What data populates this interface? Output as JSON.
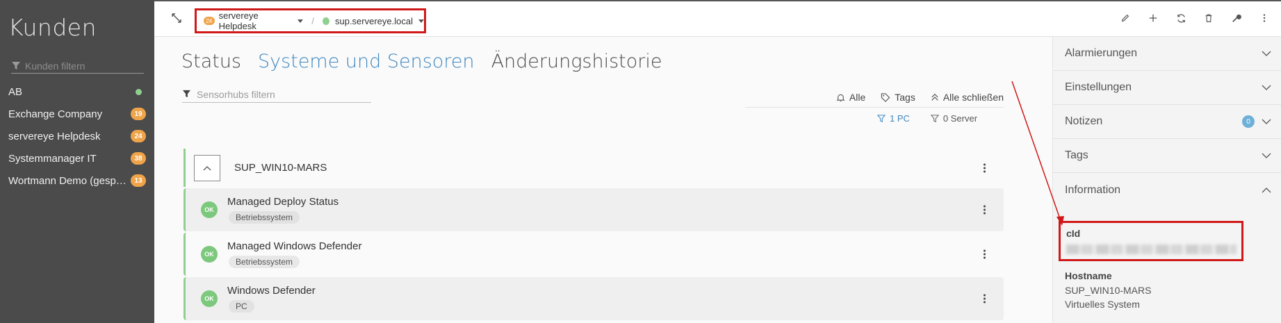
{
  "sidebar": {
    "title": "Kunden",
    "filter_placeholder": "Kunden filtern",
    "items": [
      {
        "name": "AB",
        "status": "online"
      },
      {
        "name": "Exchange Company",
        "count": "19"
      },
      {
        "name": "servereye Helpdesk",
        "count": "24"
      },
      {
        "name": "Systemmanager IT",
        "count": "38"
      },
      {
        "name": "Wortmann Demo (gespo...",
        "count": "13"
      }
    ]
  },
  "breadcrumb": {
    "customer_badge": "24",
    "customer": "servereye Helpdesk",
    "separator": "/",
    "system": "sup.servereye.local"
  },
  "toolbar": {
    "icons": [
      "pencil-icon",
      "plus-icon",
      "refresh-icon",
      "trash-icon",
      "wrench-icon",
      "more-vertical-icon"
    ]
  },
  "main": {
    "tabs": [
      {
        "label": "Status",
        "active": false
      },
      {
        "label": "Systeme und Sensoren",
        "active": true
      },
      {
        "label": "Änderungshistorie",
        "active": false
      }
    ],
    "hub_filter_placeholder": "Sensorhubs filtern",
    "actions": {
      "all": "Alle",
      "tags": "Tags",
      "close_all": "Alle schließen",
      "pc": "1 PC",
      "server": "0 Server"
    },
    "hub": {
      "name": "SUP_WIN10-MARS"
    },
    "sensors": [
      {
        "status": "OK",
        "title": "Managed Deploy Status",
        "tag": "Betriebssystem"
      },
      {
        "status": "OK",
        "title": "Managed Windows Defender",
        "tag": "Betriebssystem"
      },
      {
        "status": "OK",
        "title": "Windows Defender",
        "tag": "PC"
      }
    ]
  },
  "right_panel": {
    "sections": [
      {
        "label": "Alarmierungen",
        "expanded": false
      },
      {
        "label": "Einstellungen",
        "expanded": false
      },
      {
        "label": "Notizen",
        "badge": "0",
        "expanded": false
      },
      {
        "label": "Tags",
        "expanded": false
      },
      {
        "label": "Information",
        "expanded": true
      }
    ],
    "info": {
      "cid_label": "cId",
      "hostname_label": "Hostname",
      "hostname_value": "SUP_WIN10-MARS",
      "system_type": "Virtuelles System"
    }
  },
  "colors": {
    "accent_blue": "#3f87bf",
    "status_green": "#8fd08f",
    "badge_orange": "#f0a44a",
    "annotation_red": "#d01818"
  }
}
